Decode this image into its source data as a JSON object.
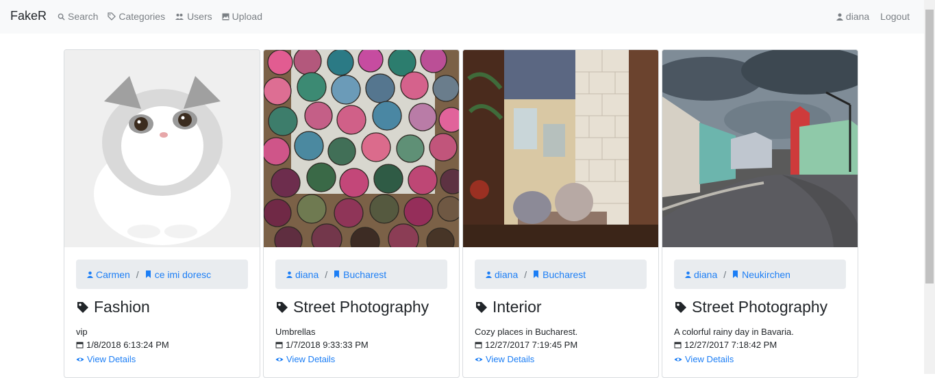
{
  "app": {
    "brand": "FakeR"
  },
  "nav": {
    "left": [
      {
        "label": "Search",
        "icon": "search-icon"
      },
      {
        "label": "Categories",
        "icon": "tag-icon"
      },
      {
        "label": "Users",
        "icon": "users-icon"
      },
      {
        "label": "Upload",
        "icon": "image-icon"
      }
    ],
    "user": "diana",
    "logout": "Logout"
  },
  "cards": [
    {
      "user": "Carmen",
      "album": "ce imi doresc",
      "category": "Fashion",
      "description": "vip",
      "date": "1/8/2018 6:13:24 PM",
      "details": "View Details",
      "image": "cat"
    },
    {
      "user": "diana",
      "album": "Bucharest",
      "category": "Street Photography",
      "description": "Umbrellas",
      "date": "1/7/2018 9:33:33 PM",
      "details": "View Details",
      "image": "umbrellas"
    },
    {
      "user": "diana",
      "album": "Bucharest",
      "category": "Interior",
      "description": "Cozy places in Bucharest.",
      "date": "12/27/2017 7:19:45 PM",
      "details": "View Details",
      "image": "interior"
    },
    {
      "user": "diana",
      "album": "Neukirchen",
      "category": "Street Photography",
      "description": "A colorful rainy day in Bavaria.",
      "date": "12/27/2017 7:18:42 PM",
      "details": "View Details",
      "image": "street"
    }
  ],
  "colors": {
    "link": "#1c7ef5",
    "navbar": "#f8f9fa",
    "breadcrumb": "#e9ecef"
  }
}
